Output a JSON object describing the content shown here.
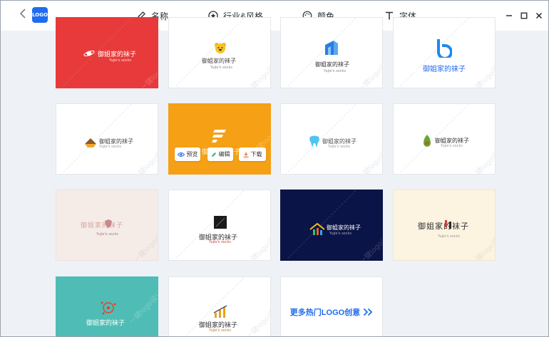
{
  "app": {
    "logo_text": "LOGO"
  },
  "tabs": [
    {
      "label": "名称",
      "icon": "pencil-icon"
    },
    {
      "label": "行业&风格",
      "icon": "star-circle-icon"
    },
    {
      "label": "颜色",
      "icon": "palette-icon"
    },
    {
      "label": "字体",
      "icon": "text-t-icon"
    }
  ],
  "watermark": "一键logo设计",
  "brand_text": "御姐家的袜子",
  "sub_text": "Yujie's socks",
  "hover_actions": {
    "preview": "预览",
    "edit": "编辑",
    "download": "下载"
  },
  "more_link": "更多热门LOGO创意",
  "colors": {
    "accent": "#1e6cf0",
    "red_card": "#e83a3a",
    "orange_card": "#f5a015",
    "navy_card": "#0b1446",
    "teal_card": "#4fbdb5",
    "cream_card": "#fdf3e1",
    "pink_card": "#f5ece8"
  }
}
